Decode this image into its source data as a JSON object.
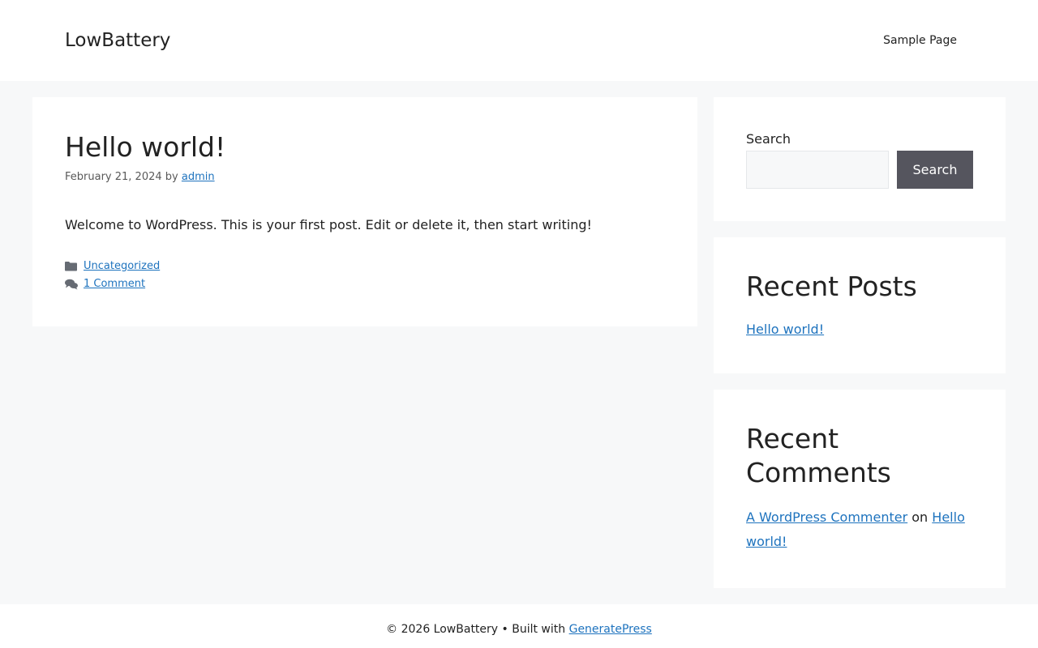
{
  "header": {
    "site_title": "LowBattery",
    "nav": [
      {
        "label": "Sample Page"
      }
    ]
  },
  "post": {
    "title": "Hello world!",
    "date": "February 21, 2024",
    "by": "by",
    "author": "admin",
    "content": "Welcome to WordPress. This is your first post. Edit or delete it, then start writing!",
    "category": "Uncategorized",
    "comments": "1 Comment"
  },
  "sidebar": {
    "search": {
      "label": "Search",
      "placeholder": "",
      "button": "Search"
    },
    "recent_posts": {
      "title": "Recent Posts",
      "items": [
        {
          "label": "Hello world!"
        }
      ]
    },
    "recent_comments": {
      "title": "Recent Comments",
      "author": "A WordPress Commenter",
      "on": "on",
      "post": "Hello world!"
    }
  },
  "footer": {
    "copyright": "© 2026 LowBattery • Built with",
    "link": "GeneratePress"
  },
  "colors": {
    "link": "#1e73be",
    "background": "#f7f8f9",
    "button": "#55555e"
  }
}
